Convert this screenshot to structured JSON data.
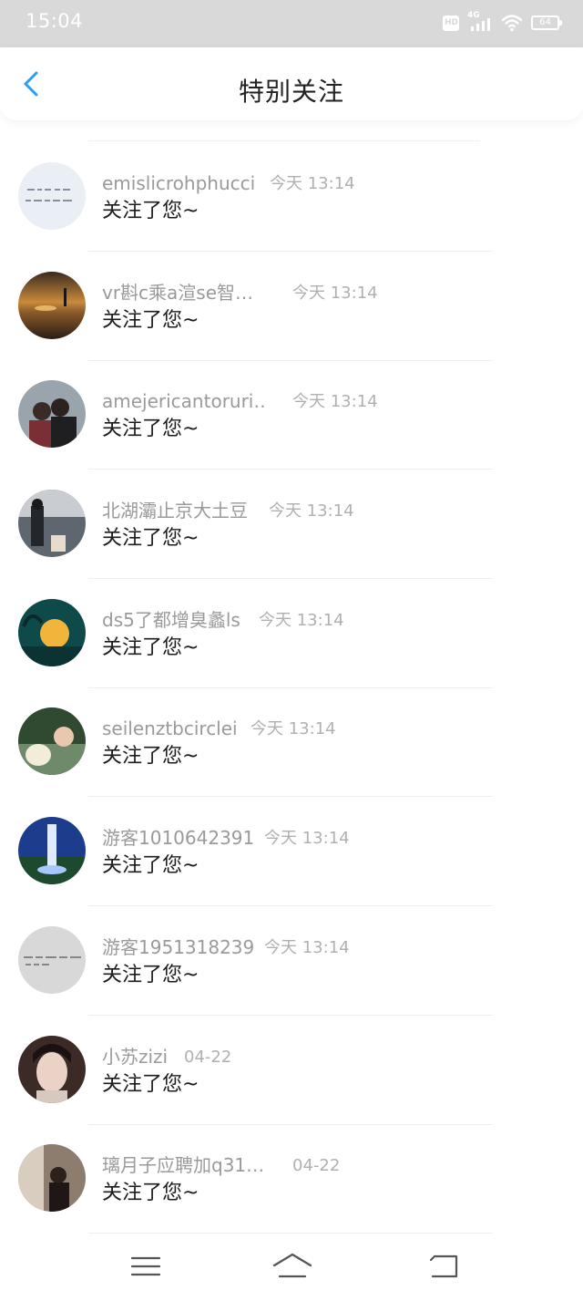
{
  "status_bar": {
    "time": "15:04",
    "hd_label": "HD",
    "network_label": "4G",
    "battery_level": "64"
  },
  "header": {
    "title": "特别关注"
  },
  "items": [
    {
      "name": "emislicrohphucci",
      "time": "今天 13:14",
      "message": "关注了您~"
    },
    {
      "name": "vr斟c乘a渲se智…",
      "time": "今天 13:14",
      "message": "关注了您~"
    },
    {
      "name": "amejericantoruri…",
      "time": "今天 13:14",
      "message": "关注了您~"
    },
    {
      "name": "北湖灞止京大土豆",
      "time": "今天 13:14",
      "message": "关注了您~"
    },
    {
      "name": "ds5了都增臭蠡ls",
      "time": "今天 13:14",
      "message": "关注了您~"
    },
    {
      "name": "seilenztbcirclei",
      "time": "今天 13:14",
      "message": "关注了您~"
    },
    {
      "name": "游客1010642391",
      "time": "今天 13:14",
      "message": "关注了您~"
    },
    {
      "name": "游客1951318239",
      "time": "今天 13:14",
      "message": "关注了您~"
    },
    {
      "name": "小苏zizi",
      "time": "04-22",
      "message": "关注了您~"
    },
    {
      "name": "璃月子应聘加q31…",
      "time": "04-22",
      "message": "关注了您~"
    }
  ],
  "colors": {
    "accent": "#2a9df4",
    "status_bar_bg": "#d9d9d9",
    "name_text": "#9a9a9a",
    "time_text": "#b0b0b0",
    "message_text": "#1c1c1c"
  },
  "icons": {
    "back": "chevron-left-icon",
    "menu": "menu-icon",
    "home": "home-icon",
    "return": "return-icon"
  }
}
